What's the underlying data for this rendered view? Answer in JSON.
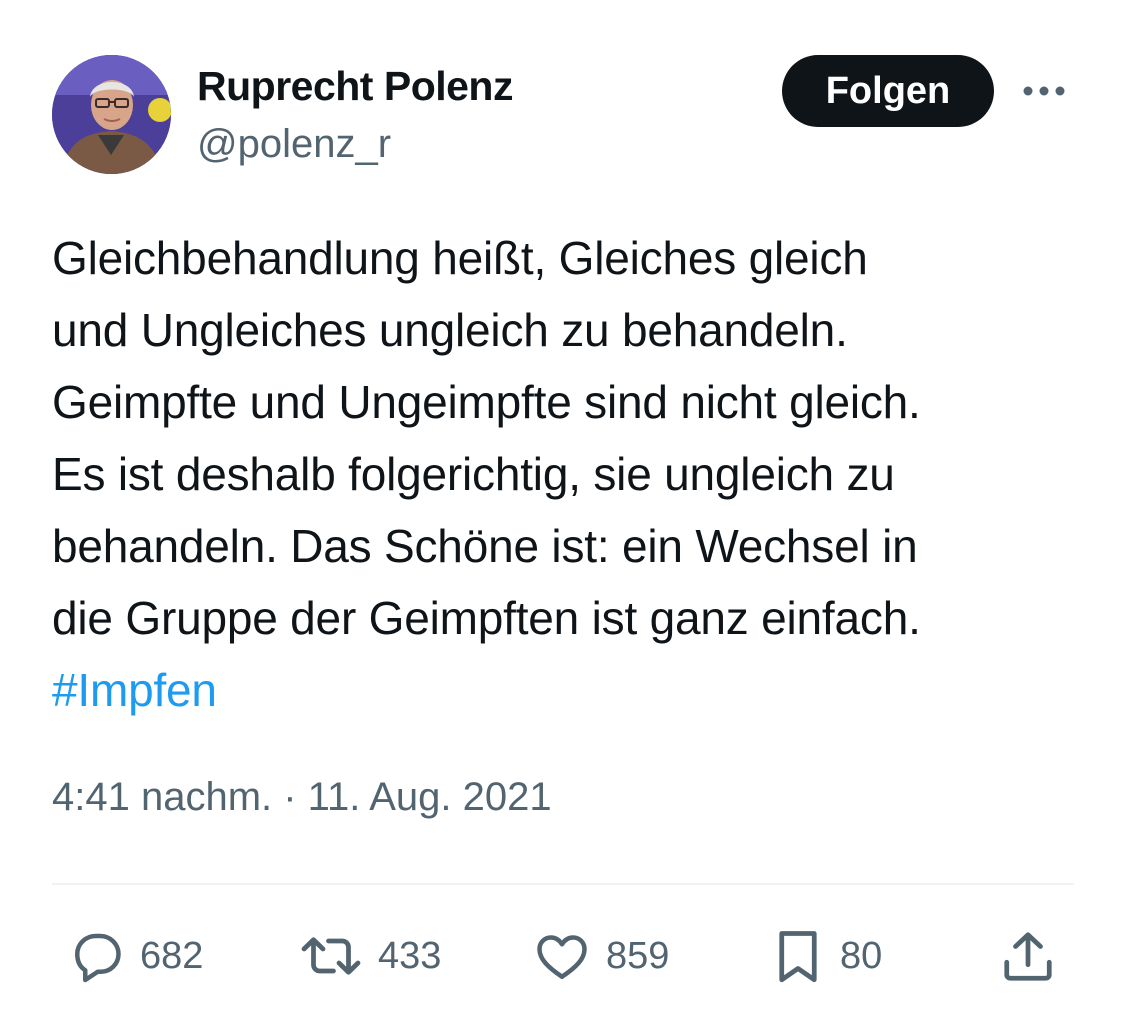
{
  "author": {
    "name": "Ruprecht Polenz",
    "handle": "@polenz_r"
  },
  "header": {
    "follow_label": "Folgen",
    "more_icon": "more-horizontal-icon"
  },
  "tweet": {
    "lines": [
      "Gleichbehandlung heißt, Gleiches gleich",
      "und Ungleiches ungleich zu behandeln.",
      "Geimpfte und Ungeimpfte sind nicht gleich.",
      "Es ist deshalb folgerichtig, sie ungleich zu",
      "behandeln. Das Schöne ist: ein Wechsel in",
      "die Gruppe der Geimpften ist ganz einfach."
    ],
    "hashtag": "#Impfen",
    "timestamp": "4:41 nachm. · 11. Aug. 2021"
  },
  "actions": {
    "reply": {
      "icon": "reply-icon",
      "count": "682"
    },
    "retweet": {
      "icon": "retweet-icon",
      "count": "433"
    },
    "like": {
      "icon": "heart-icon",
      "count": "859"
    },
    "bookmark": {
      "icon": "bookmark-icon",
      "count": "80"
    },
    "share": {
      "icon": "share-icon"
    }
  },
  "colors": {
    "text": "#0f1419",
    "secondary": "#536471",
    "link": "#1d9bf0",
    "button_bg": "#0f1419",
    "button_text": "#ffffff"
  }
}
